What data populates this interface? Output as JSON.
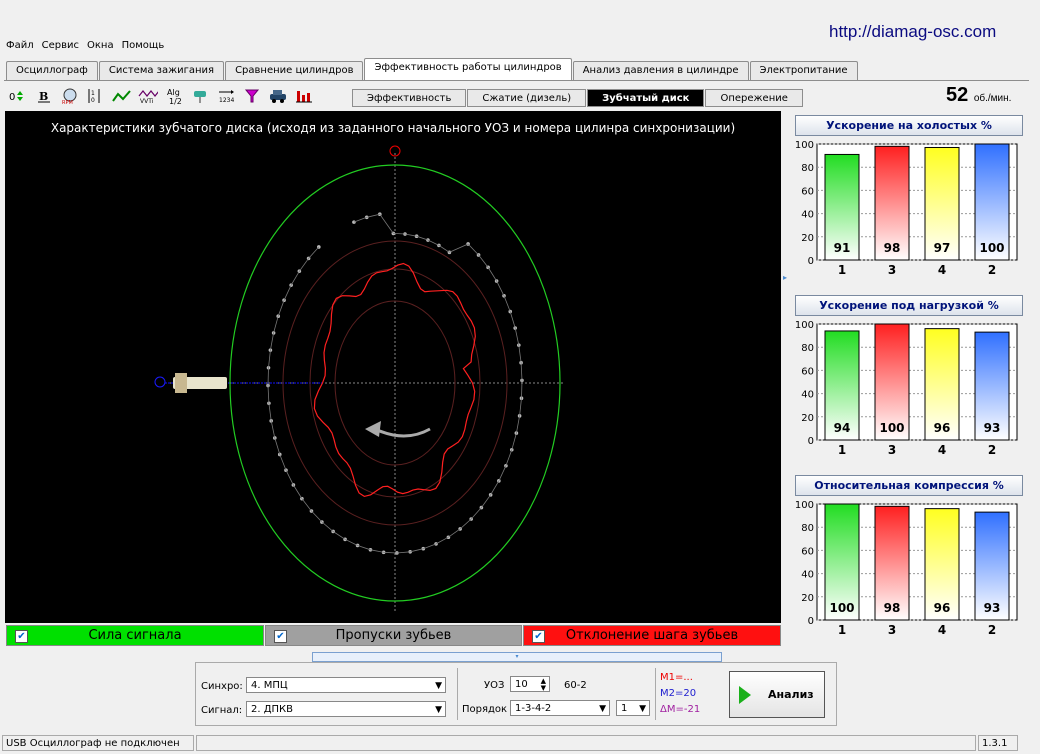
{
  "url": "http://diamag-osc.com",
  "menu": [
    "Файл",
    "Сервис",
    "Окна",
    "Помощь"
  ],
  "main_tabs": [
    {
      "label": "Осциллограф"
    },
    {
      "label": "Система зажигания"
    },
    {
      "label": "Сравнение цилиндров"
    },
    {
      "label": "Эффективность работы цилиндров",
      "active": true
    },
    {
      "label": "Анализ давления в цилиндре"
    },
    {
      "label": "Электропитание"
    }
  ],
  "sub_tabs": [
    {
      "label": "Эффективность"
    },
    {
      "label": "Сжатие (дизель)"
    },
    {
      "label": "Зубчатый диск",
      "active": true
    },
    {
      "label": "Опережение"
    }
  ],
  "rpm": {
    "value": "52",
    "unit": "об./мин."
  },
  "scope": {
    "title": "Характеристики зубчатого диска (исходя из заданного начального УОЗ и номера цилинра синхронизации)"
  },
  "legend": [
    {
      "label": "Сила сигнала",
      "color": "#00e000",
      "text_color": "#000000",
      "checked": true
    },
    {
      "label": "Пропуски зубьев",
      "color": "#a0a0a0",
      "text_color": "#000000",
      "checked": true
    },
    {
      "label": "Отклонение шага зубьев",
      "color": "#ff1010",
      "text_color": "#000000",
      "checked": true
    }
  ],
  "chart_data": [
    {
      "type": "bar",
      "title": "Ускорение на холостых %",
      "categories": [
        "1",
        "3",
        "4",
        "2"
      ],
      "values": [
        91,
        98,
        97,
        100
      ],
      "ylim": [
        0,
        100
      ],
      "yticks": [
        "0",
        "20",
        "40",
        "60",
        "80",
        "100"
      ],
      "colors": [
        "#22dd22",
        "#ff2020",
        "#ffff20",
        "#3070ff"
      ]
    },
    {
      "type": "bar",
      "title": "Ускорение под нагрузкой %",
      "categories": [
        "1",
        "3",
        "4",
        "2"
      ],
      "values": [
        94,
        100,
        96,
        93
      ],
      "ylim": [
        0,
        100
      ],
      "yticks": [
        "0",
        "20",
        "40",
        "60",
        "80",
        "100"
      ],
      "colors": [
        "#22dd22",
        "#ff2020",
        "#ffff20",
        "#3070ff"
      ]
    },
    {
      "type": "bar",
      "title": "Относительная компрессия %",
      "categories": [
        "1",
        "3",
        "4",
        "2"
      ],
      "values": [
        100,
        98,
        96,
        93
      ],
      "ylim": [
        0,
        100
      ],
      "yticks": [
        "0",
        "20",
        "40",
        "60",
        "80",
        "100"
      ],
      "colors": [
        "#22dd22",
        "#ff2020",
        "#ffff20",
        "#3070ff"
      ]
    }
  ],
  "controls": {
    "sync_label": "Синхро:",
    "sync_value": "4.  МПЦ",
    "signal_label": "Сигнал:",
    "signal_value": "2.  ДПКВ",
    "uoz_label": "УОЗ",
    "uoz_value": "10",
    "teeth": "60-2",
    "order_label": "Порядок",
    "order_value": "1-3-4-2",
    "cyl_value": "1",
    "m1": "M1=...",
    "m2": "M2=20",
    "dm": "ΔM=-21",
    "analyze_label": "Анализ"
  },
  "status": {
    "message": "USB Осциллограф не подключен",
    "version": "1.3.1"
  }
}
